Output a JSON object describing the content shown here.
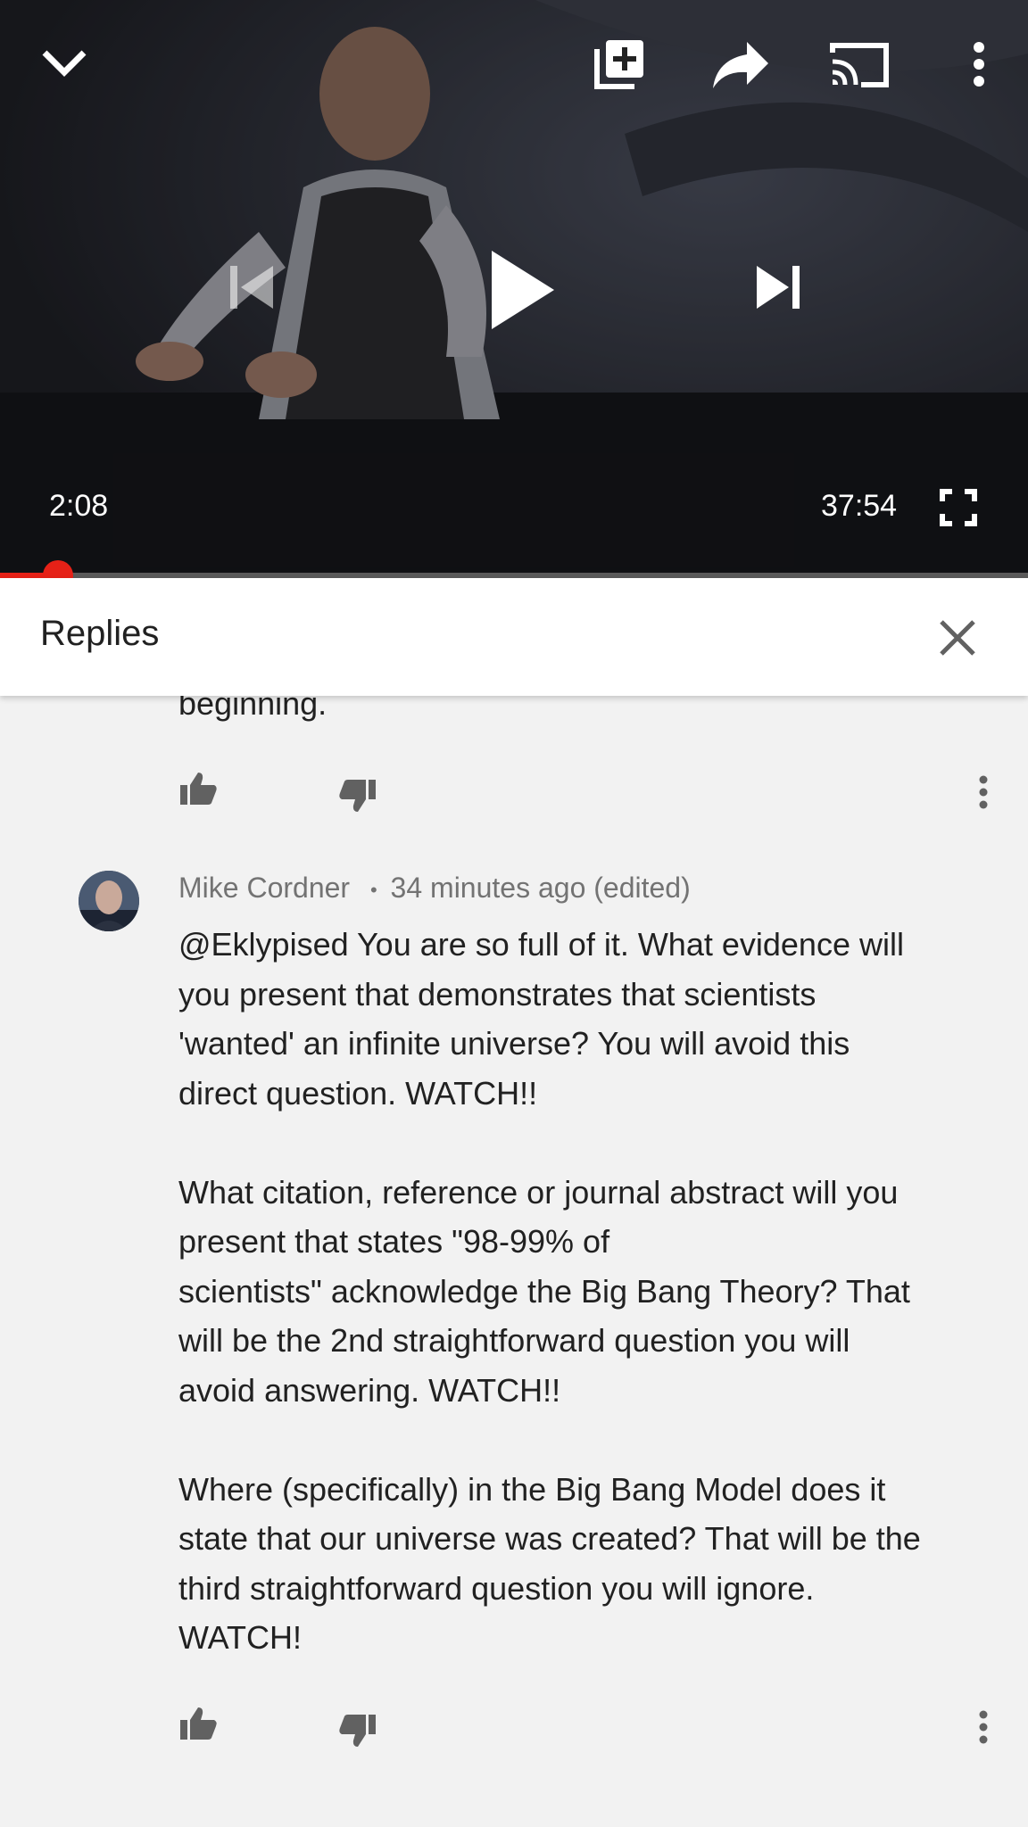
{
  "player": {
    "current_time": "2:08",
    "duration": "37:54",
    "progress": 0.056,
    "accent": "#e62117",
    "icons": {
      "minimize": "chevron-down-icon",
      "add_to_playlist": "add-to-playlist-icon",
      "share": "share-icon",
      "cast": "cast-icon",
      "more": "more-vert-icon",
      "previous": "skip-previous-icon",
      "play": "play-icon",
      "next": "skip-next-icon",
      "fullscreen": "fullscreen-icon"
    }
  },
  "replies": {
    "title": "Replies",
    "close_icon": "close-icon"
  },
  "comments": [
    {
      "text_tail": "beginning."
    },
    {
      "author": "Mike Cordner",
      "separator": "•",
      "timestamp": "34 minutes ago (edited)",
      "text": "@Eklypised You are so full of it. What evidence will\nyou present that demonstrates that scientists\n'wanted' an infinite universe? You will avoid this\ndirect question. WATCH!!\n\nWhat citation, reference or journal abstract will you\npresent that states \"98-99% of\nscientists\" acknowledge the Big Bang Theory? That\nwill be the 2nd straightforward question you will\navoid answering. WATCH!!\n\nWhere (specifically) in the Big Bang Model does it\nstate that our universe was created? That will be the\nthird straightforward question you will ignore.\nWATCH!"
    }
  ]
}
